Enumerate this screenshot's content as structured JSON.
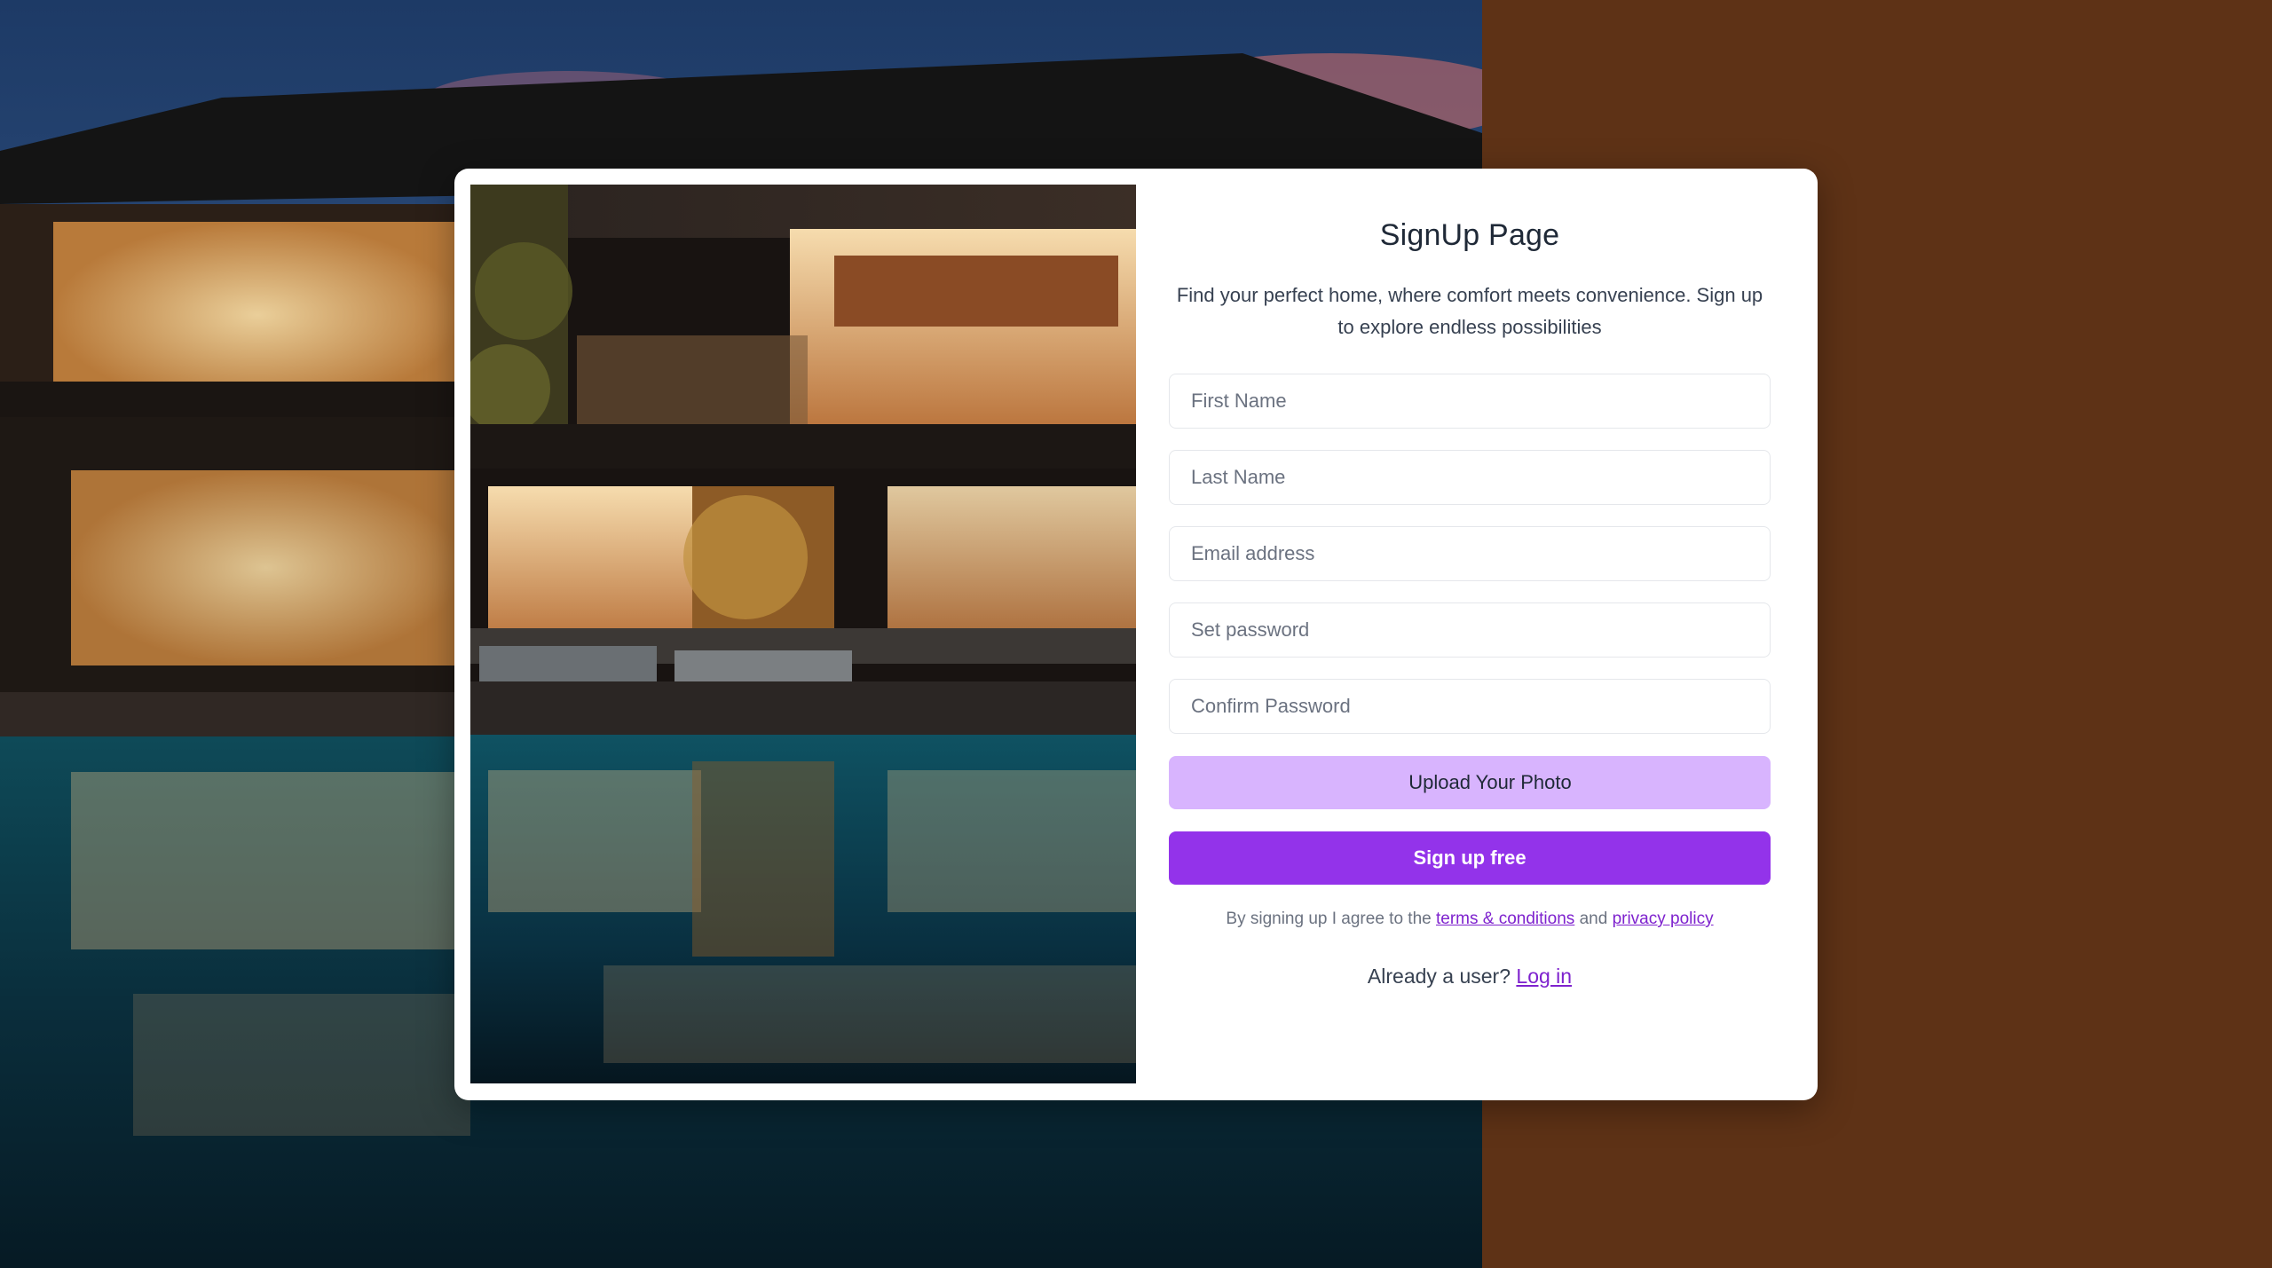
{
  "page": {
    "title": "SignUp Page",
    "subtitle": "Find your perfect home, where comfort meets convenience. Sign up to explore endless possibilities"
  },
  "form": {
    "first_name_placeholder": "First Name",
    "last_name_placeholder": "Last Name",
    "email_placeholder": "Email address",
    "password_placeholder": "Set password",
    "confirm_password_placeholder": "Confirm Password",
    "upload_label": "Upload Your Photo",
    "signup_label": "Sign up free"
  },
  "terms": {
    "prefix": "By signing up I agree to the",
    "terms_link": "terms & conditions",
    "conjunction": "and",
    "privacy_link": "privacy policy"
  },
  "login": {
    "prompt": "Already a user?",
    "link": "Log in"
  },
  "colors": {
    "accent": "#9333ea",
    "accent_light": "#d8b4fe",
    "background_brown": "#5e3216"
  }
}
